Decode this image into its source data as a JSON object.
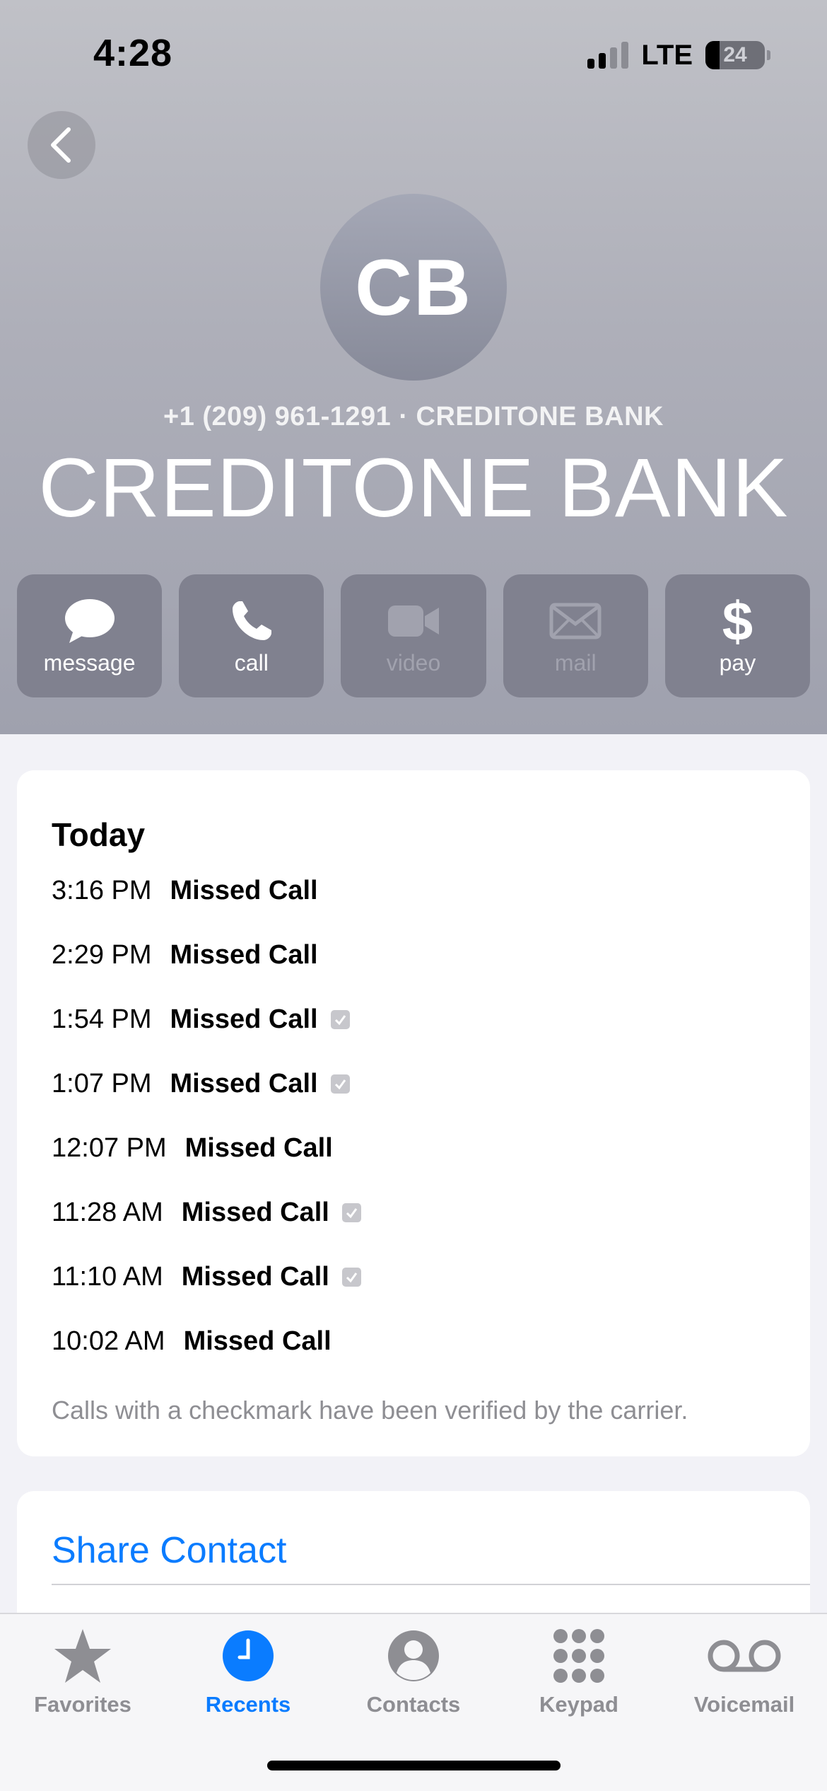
{
  "status_bar": {
    "time": "4:28",
    "network": "LTE",
    "battery": "24"
  },
  "contact": {
    "initials": "CB",
    "subtitle": "+1 (209) 961-1291 · CREDITONE BANK",
    "name": "CREDITONE BANK"
  },
  "actions": [
    {
      "label": "message",
      "icon": "message-bubble-icon",
      "enabled": true
    },
    {
      "label": "call",
      "icon": "phone-icon",
      "enabled": true
    },
    {
      "label": "video",
      "icon": "video-camera-icon",
      "enabled": false
    },
    {
      "label": "mail",
      "icon": "envelope-icon",
      "enabled": false
    },
    {
      "label": "pay",
      "icon": "dollar-icon",
      "enabled": true
    }
  ],
  "history": {
    "heading": "Today",
    "calls": [
      {
        "time": "3:16 PM",
        "type": "Missed Call",
        "verified": false
      },
      {
        "time": "2:29 PM",
        "type": "Missed Call",
        "verified": false
      },
      {
        "time": "1:54 PM",
        "type": "Missed Call",
        "verified": true
      },
      {
        "time": "1:07 PM",
        "type": "Missed Call",
        "verified": true
      },
      {
        "time": "12:07 PM",
        "type": "Missed Call",
        "verified": false
      },
      {
        "time": "11:28 AM",
        "type": "Missed Call",
        "verified": true
      },
      {
        "time": "11:10 AM",
        "type": "Missed Call",
        "verified": true
      },
      {
        "time": "10:02 AM",
        "type": "Missed Call",
        "verified": false
      }
    ],
    "note": "Calls with a checkmark have been verified by the carrier."
  },
  "share": {
    "label": "Share Contact"
  },
  "tabs": [
    {
      "label": "Favorites",
      "icon": "star-icon",
      "active": false
    },
    {
      "label": "Recents",
      "icon": "clock-icon",
      "active": true
    },
    {
      "label": "Contacts",
      "icon": "person-circle-icon",
      "active": false
    },
    {
      "label": "Keypad",
      "icon": "keypad-icon",
      "active": false
    },
    {
      "label": "Voicemail",
      "icon": "voicemail-icon",
      "active": false
    }
  ],
  "colors": {
    "accent": "#0a7cff",
    "header_bg": "#aeafb9",
    "action_bg": "#80818f"
  }
}
